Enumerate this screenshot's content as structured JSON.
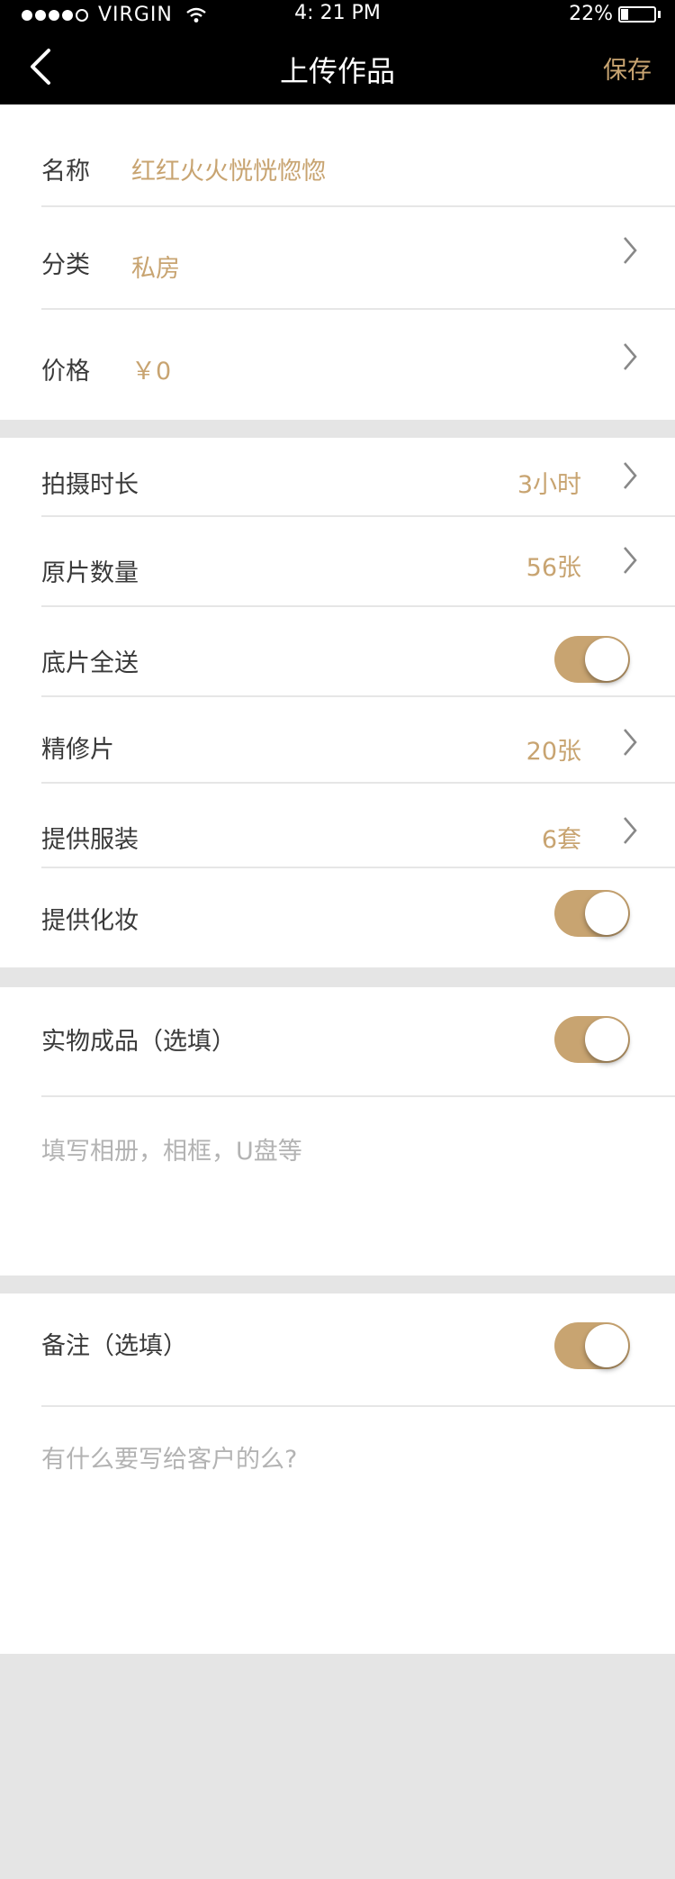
{
  "status_bar": {
    "signal_bars": 4,
    "carrier": "VIRGIN",
    "time": "4: 21 PM",
    "battery": "22%"
  },
  "nav": {
    "title": "上传作品",
    "save_label": "保存"
  },
  "basic": {
    "name_label": "名称",
    "name_value": "红红火火恍恍惚惚",
    "category_label": "分类",
    "category_value": "私房",
    "price_label": "价格",
    "price_value": "￥0"
  },
  "details": {
    "duration_label": "拍摄时长",
    "duration_value": "3小时",
    "originals_label": "原片数量",
    "originals_value": "56张",
    "negatives_label": "底片全送",
    "negatives_on": true,
    "retouched_label": "精修片",
    "retouched_value": "20张",
    "costume_label": "提供服装",
    "costume_value": "6套",
    "makeup_label": "提供化妆",
    "makeup_on": true
  },
  "physical": {
    "label": "实物成品（选填）",
    "on": true,
    "placeholder": "填写相册，相框，U盘等"
  },
  "remarks": {
    "label": "备注（选填）",
    "on": true,
    "placeholder": "有什么要写给客户的么?"
  },
  "colors": {
    "accent": "#c8a471",
    "header_bg": "#000000",
    "page_bg": "#e5e5e5"
  }
}
